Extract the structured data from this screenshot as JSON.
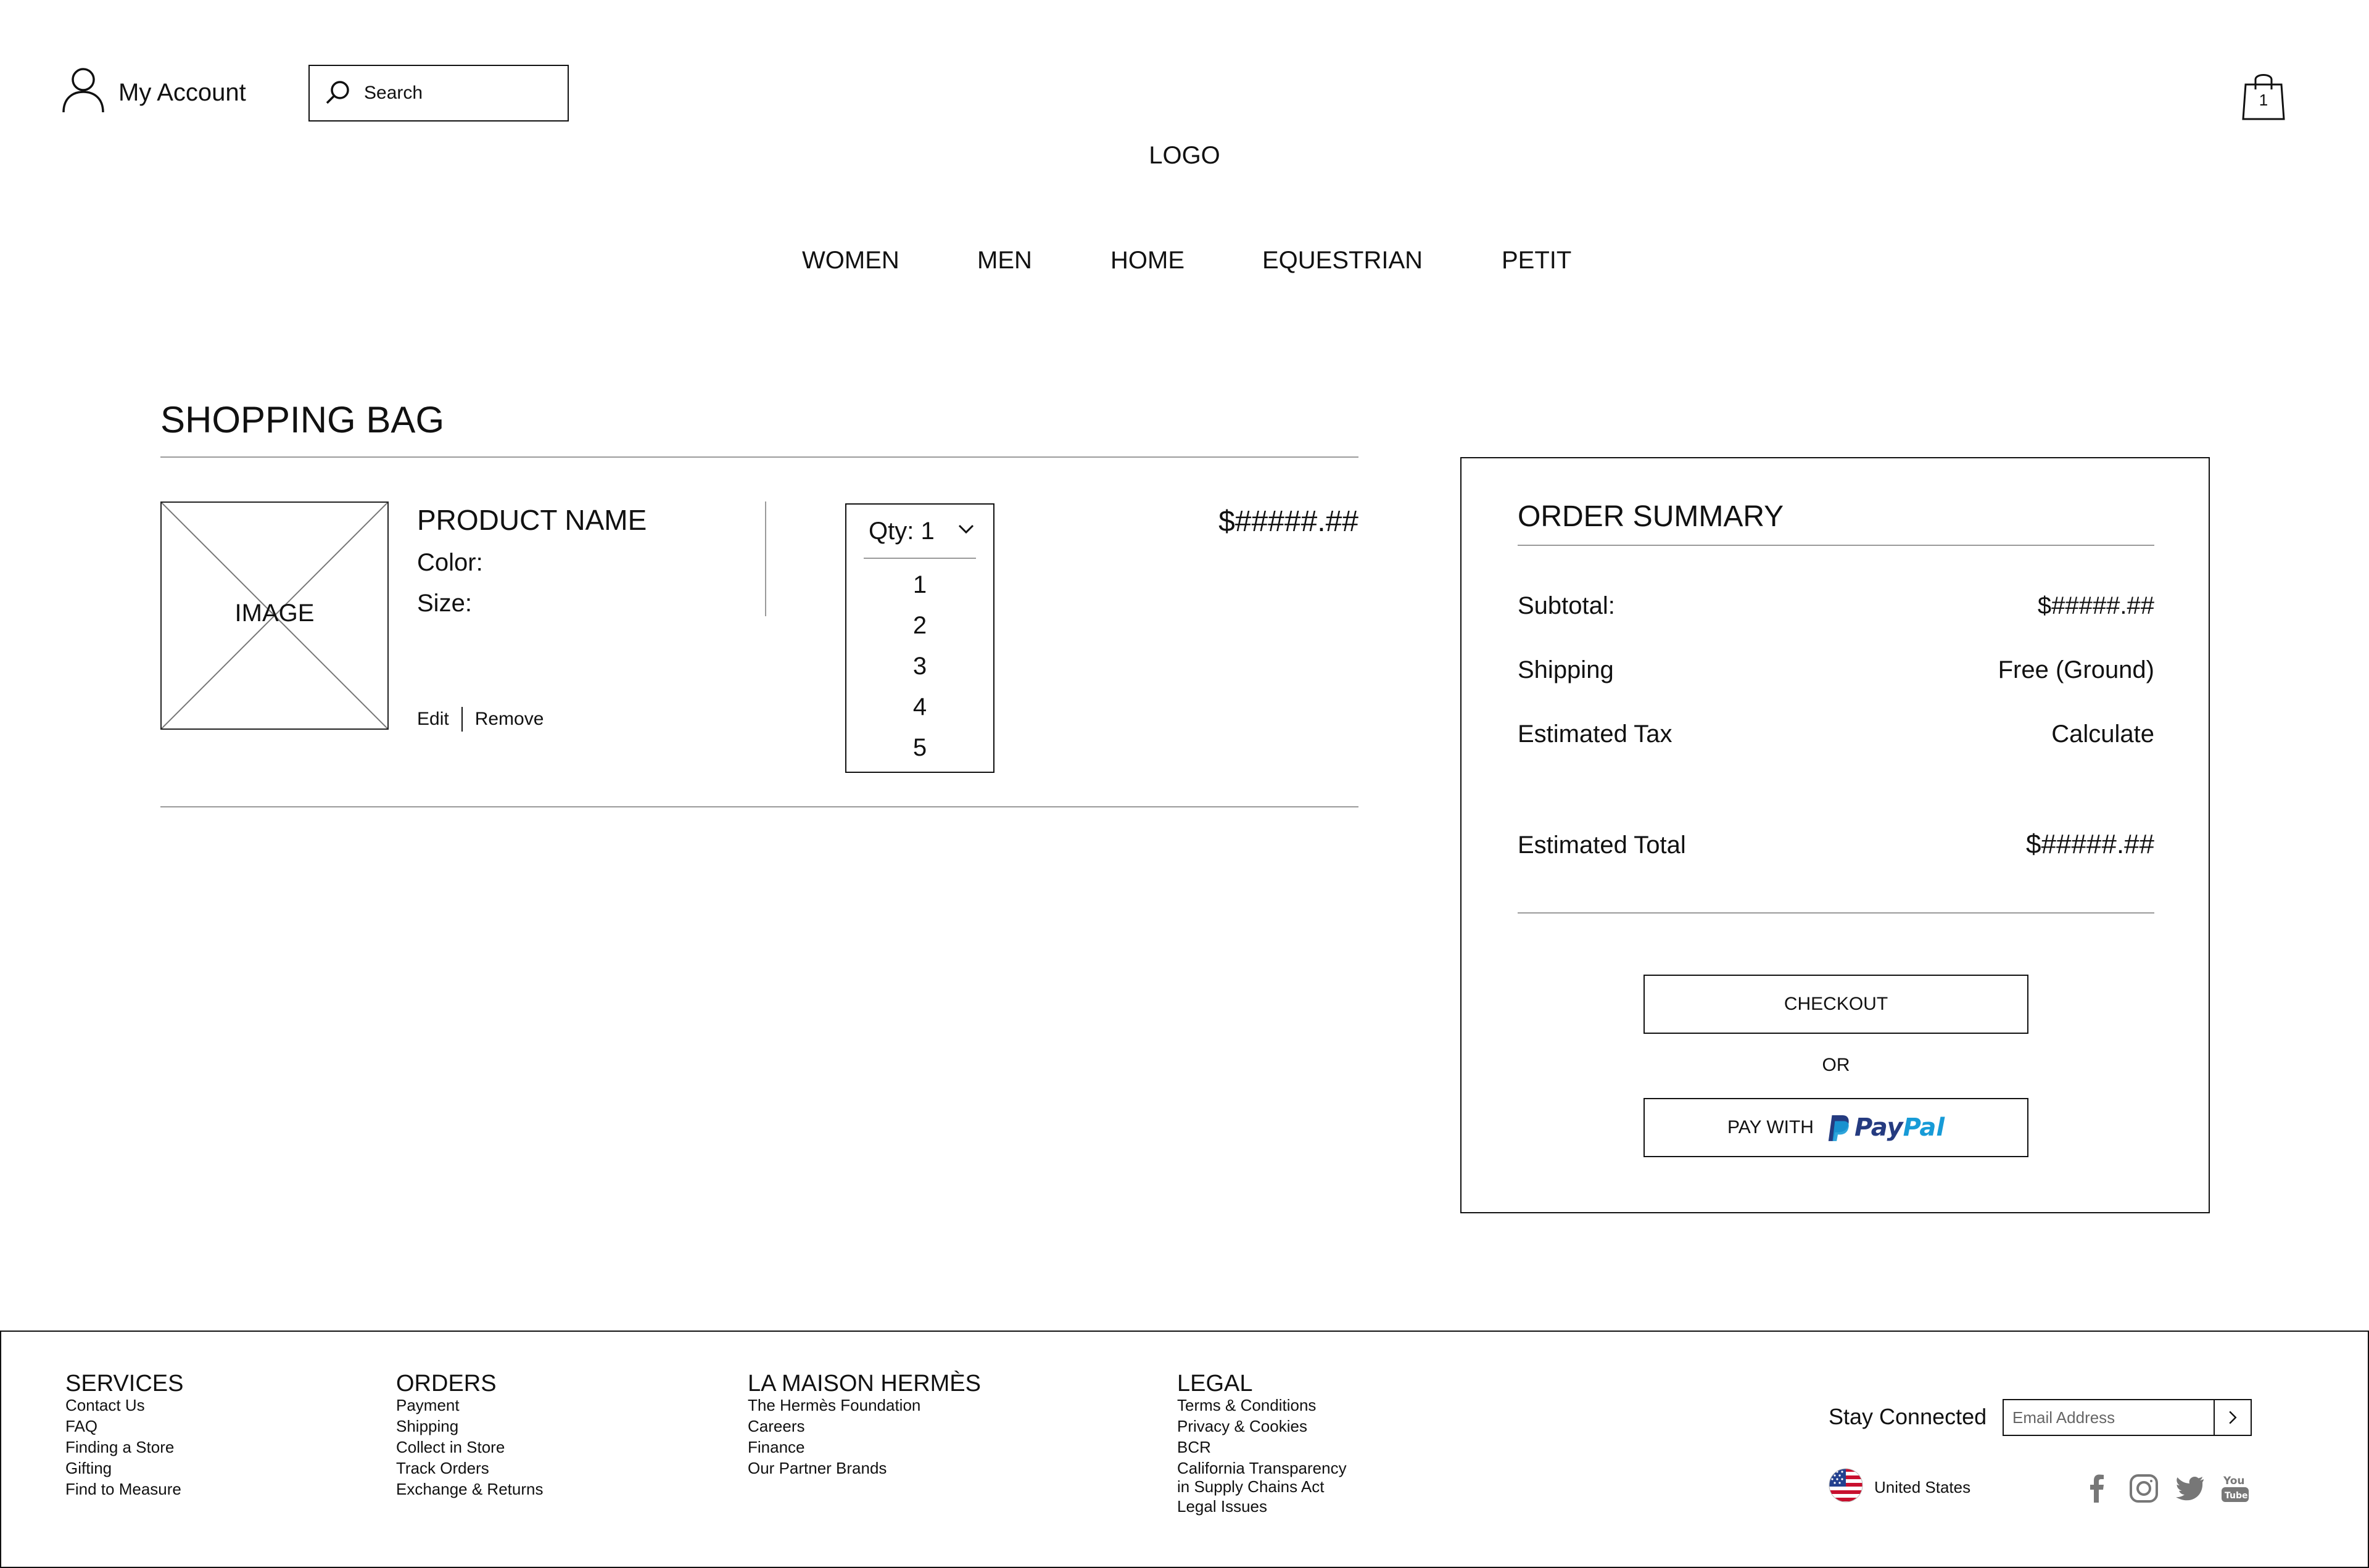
{
  "header": {
    "account_label": "My Account",
    "search_placeholder": "Search",
    "bag_count": "1",
    "logo": "LOGO"
  },
  "nav": {
    "items": [
      "WOMEN",
      "MEN",
      "HOME",
      "EQUESTRIAN",
      "PETIT"
    ]
  },
  "bag": {
    "title": "SHOPPING BAG",
    "item": {
      "image_label": "IMAGE",
      "name": "PRODUCT NAME",
      "color_label": "Color:",
      "size_label": "Size:",
      "edit_label": "Edit",
      "remove_label": "Remove",
      "qty_label": "Qty: 1",
      "qty_options": [
        "1",
        "2",
        "3",
        "4",
        "5"
      ],
      "price": "$#####.##"
    }
  },
  "summary": {
    "title": "ORDER SUMMARY",
    "subtotal_label": "Subtotal:",
    "subtotal_value": "$#####.##",
    "shipping_label": "Shipping",
    "shipping_value": "Free (Ground)",
    "tax_label": "Estimated Tax",
    "tax_value": "Calculate",
    "total_label": "Estimated Total",
    "total_value": "$#####.##",
    "checkout_label": "CHECKOUT",
    "or_label": "OR",
    "paypal_prefix": "PAY WITH",
    "paypal_word_a": "Pay",
    "paypal_word_b": "Pal",
    "paypal_colors": {
      "dark": "#253b80",
      "light": "#179bd7"
    }
  },
  "footer": {
    "columns": [
      {
        "title": "SERVICES",
        "links": [
          "Contact Us",
          "FAQ",
          "Finding a Store",
          "Gifting",
          "Find to Measure"
        ]
      },
      {
        "title": "ORDERS",
        "links": [
          "Payment",
          "Shipping",
          "Collect in Store",
          "Track Orders",
          "Exchange & Returns"
        ]
      },
      {
        "title": "LA MAISON HERMÈS",
        "links": [
          "The Hermès Foundation",
          "Careers",
          "Finance",
          "Our Partner Brands"
        ]
      },
      {
        "title": "LEGAL",
        "links": [
          "Terms & Conditions",
          "Privacy & Cookies",
          "BCR",
          "California Transparency",
          "in Supply Chains Act",
          "Legal Issues"
        ]
      }
    ],
    "stay_connected": "Stay Connected",
    "email_placeholder": "Email Address",
    "country": "United States",
    "social_icons": [
      "facebook-icon",
      "instagram-icon",
      "twitter-icon",
      "youtube-icon"
    ]
  }
}
